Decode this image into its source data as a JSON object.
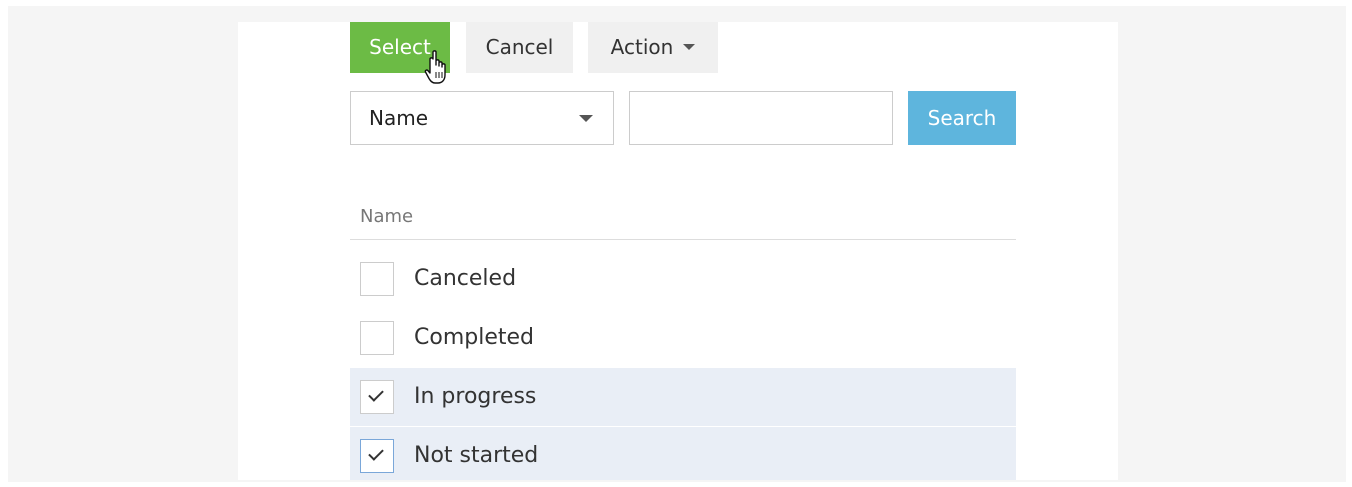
{
  "toolbar": {
    "select_label": "Select",
    "cancel_label": "Cancel",
    "action_label": "Action"
  },
  "search": {
    "field_selected": "Name",
    "value": "",
    "button_label": "Search"
  },
  "table": {
    "column_header": "Name",
    "rows": [
      {
        "label": "Canceled",
        "checked": false
      },
      {
        "label": "Completed",
        "checked": false
      },
      {
        "label": "In progress",
        "checked": true
      },
      {
        "label": "Not started",
        "checked": true
      }
    ]
  },
  "colors": {
    "select_button": "#6cbb45",
    "search_button": "#5eb5dd",
    "checked_row": "#e9eef6"
  },
  "icons": {
    "cursor": "hand-pointer-icon",
    "action_caret": "caret-down-icon",
    "select_caret": "caret-down-icon",
    "check": "checkmark-icon"
  }
}
